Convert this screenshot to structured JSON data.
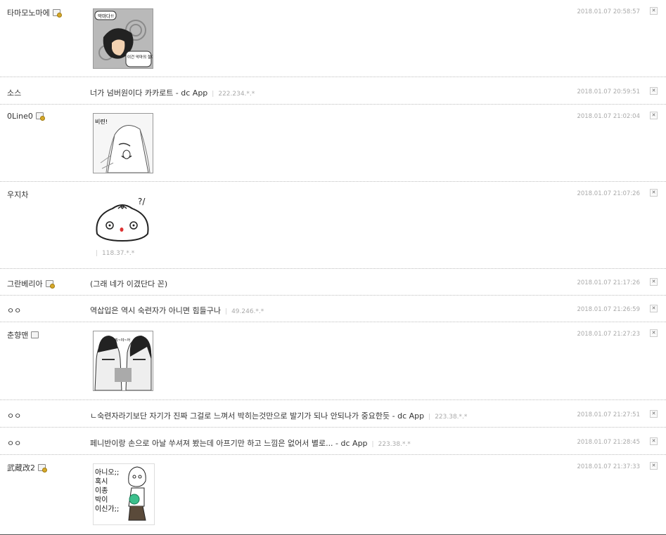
{
  "comments": [
    {
      "nick": "타마모노마에",
      "badge": "gold",
      "image": "comic-panel-1",
      "bubble1": "악마다!!",
      "bubble2": "이건 악마의 절이야!!",
      "time": "2018.01.07 20:58:57"
    },
    {
      "nick": "소스",
      "badge": "none",
      "text": "너가 넘버원이다 카카로트 - dc App",
      "ip": "222.234.*.*",
      "time": "2018.01.07 20:59:51"
    },
    {
      "nick": "0Line0",
      "badge": "gold",
      "image": "comic-panel-2",
      "bubble": "비련!",
      "time": "2018.01.07 21:02:04"
    },
    {
      "nick": "우지차",
      "badge": "none",
      "image": "dumpling-sticker",
      "sticker_mark": "?/",
      "ip": "118.37.*.*",
      "time": "2018.01.07 21:07:26"
    },
    {
      "nick": "그란베리아",
      "badge": "gold",
      "text": "(그래 네가 이겼단다 꼰)",
      "time": "2018.01.07 21:17:26"
    },
    {
      "nick": "ㅇㅇ",
      "badge": "none",
      "text": "역삽입은 역시 숙련자가 아니면 힘들구나",
      "ip": "49.246.*.*",
      "time": "2018.01.07 21:26:59"
    },
    {
      "nick": "춘향맨",
      "badge": "plain",
      "image": "comic-panel-3",
      "bubble": "뭐~야~어",
      "time": "2018.01.07 21:27:23"
    },
    {
      "nick": "ㅇㅇ",
      "badge": "none",
      "text": "ㄴ숙련자라기보단 자기가 진짜 그걸로 느껴서 박히는것만으로 발기가 되나 안되나가 중요한듯 - dc App",
      "ip": "223.38.*.*",
      "time": "2018.01.07 21:27:51"
    },
    {
      "nick": "ㅇㅇ",
      "badge": "none",
      "text": "페니반이랑 손으로 아날 쑤셔져 봤는데 아프기만 하고 느낌은 없어서 별로... - dc App",
      "ip": "223.38.*.*",
      "time": "2018.01.07 21:28:45"
    },
    {
      "nick": "武蔵改2",
      "badge": "gold",
      "image": "doodle-sticker",
      "lines": [
        "아니오;;",
        "혹시",
        "이종",
        "박이",
        "이신가;;"
      ],
      "time": "2018.01.07 21:37:33"
    }
  ],
  "delete_symbol": "✕",
  "icons": {
    "badge": "gallog-icon",
    "delete": "close-icon"
  }
}
